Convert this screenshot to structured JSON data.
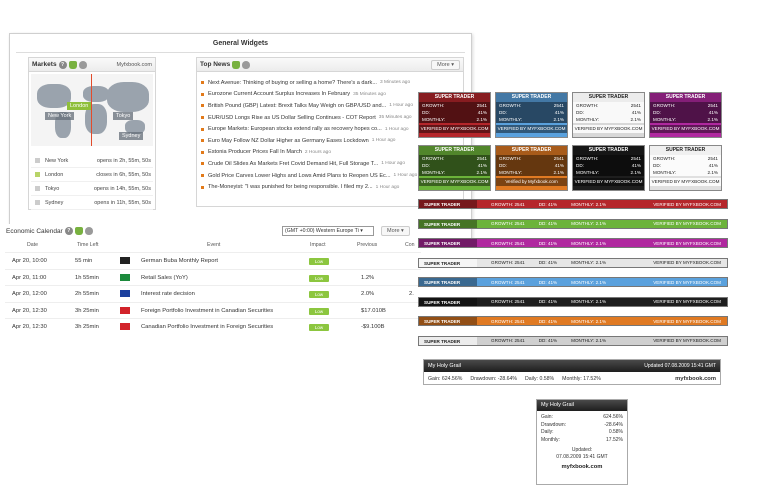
{
  "general": {
    "title": "General Widgets"
  },
  "markets": {
    "title": "Markets",
    "brand": "Myfxbook.com",
    "map_labels": [
      "London",
      "New York",
      "Tokyo",
      "Sydney"
    ],
    "rows": [
      {
        "name": "New York",
        "status": "opens in 2h, 55m, 50s"
      },
      {
        "name": "London",
        "status": "closes in 6h, 55m, 50s"
      },
      {
        "name": "Tokyo",
        "status": "opens in 14h, 55m, 50s"
      },
      {
        "name": "Sydney",
        "status": "opens in 11h, 55m, 50s"
      }
    ]
  },
  "news": {
    "title": "Top News",
    "more": "More",
    "items": [
      {
        "text": "Next Avenue: Thinking of buying or selling a home? There's a dark...",
        "time": "3 Minutes ago"
      },
      {
        "text": "Eurozone Current Account Surplus Increases In February",
        "time": "35 Minutes ago"
      },
      {
        "text": "British Pound (GBP) Latest: Brexit Talks May Weigh on GBP/USD and...",
        "time": "1 Hour ago"
      },
      {
        "text": "EUR/USD Longs Rise as US Dollar Selling Continues - COT Report",
        "time": "35 Minutes ago"
      },
      {
        "text": "Europe Markets: European stocks extend rally as recovery hopes co...",
        "time": "1 Hour ago"
      },
      {
        "text": "Euro May Follow NZ Dollar Higher as Germany Eases Lockdown",
        "time": "1 Hour ago"
      },
      {
        "text": "Estonia Producer Prices Fall In March",
        "time": "2 Hours ago"
      },
      {
        "text": "Crude Oil Slides As Markets Fret Covid Demand Hit, Full Storage T...",
        "time": "1 Hour ago"
      },
      {
        "text": "Gold Price Carves Lower Highs and Lows Amid Plans to Reopen US Ec...",
        "time": "1 Hour ago"
      },
      {
        "text": "The-Moneyist: \"I was punished for being responsible. I filed my 2...",
        "time": "1 Hour ago"
      }
    ]
  },
  "econ": {
    "title": "Economic Calendar",
    "timezone": "(GMT +0:00) Western Europe Ti",
    "more": "More",
    "columns": [
      "Date",
      "Time Left",
      "Event",
      "Impact",
      "Previous",
      "Con"
    ],
    "rows": [
      {
        "date": "Apr 20, 10:00",
        "left": "55 min",
        "event": "German Buba Monthly Report",
        "impact": "Low",
        "previous": "",
        "con": "",
        "flag": "#222222"
      },
      {
        "date": "Apr 20, 11:00",
        "left": "1h 55min",
        "event": "Retail Sales (YoY)",
        "impact": "Low",
        "previous": "1.2%",
        "con": "",
        "flag": "#1c8a3c"
      },
      {
        "date": "Apr 20, 12:00",
        "left": "2h 55min",
        "event": "Interest rate decision",
        "impact": "Low",
        "previous": "2.0%",
        "con": "2.",
        "flag": "#1b3f9e"
      },
      {
        "date": "Apr 20, 12:30",
        "left": "3h 25min",
        "event": "Foreign Portfolio Investment in Canadian Securities",
        "impact": "Low",
        "previous": "$17.010B",
        "con": "",
        "flag": "#d2232a"
      },
      {
        "date": "Apr 20, 12:30",
        "left": "3h 25min",
        "event": "Canadian Portfolio Investment in Foreign Securities",
        "impact": "Low",
        "previous": "-$9.100B",
        "con": "",
        "flag": "#d2232a"
      }
    ]
  },
  "banners": {
    "title": "SUPER TRADER",
    "growth_label": "GROWTH:",
    "growth": "2541",
    "dd_label": "DD:",
    "dd": "41%",
    "monthly_label": "MONTHLY:",
    "monthly": "2.1%",
    "verified": "VERIFIED BY MYFXBOOK.COM",
    "verified_alt": "Verified by Myfxbook.com",
    "colors": [
      "#b5262b",
      "#5aa1dd",
      "#d8d8d8",
      "#b0289f",
      "#6cb33a",
      "#e07a23",
      "#1e1e1e",
      "#e0e0e0"
    ],
    "strips": [
      "#b5262b",
      "#6cb33a",
      "#b0289f",
      "#e6e6e6",
      "#5aa1dd",
      "#1e1e1e",
      "#e07a23",
      "#cfcfcf"
    ]
  },
  "holy_h": {
    "title": "My Holy Grail",
    "updated": "Updated 07.08.2009 15:41 GMT",
    "gain": "Gain: 624.56%",
    "drawdown": "Drawdown: -28.64%",
    "daily": "Daily: 0.58%",
    "monthly": "Monthly: 17.52%",
    "logo": "myfxbook.com"
  },
  "holy_v": {
    "title": "My Holy Grail",
    "rows": [
      {
        "label": "Gain:",
        "value": "624.56%"
      },
      {
        "label": "Drawdown:",
        "value": "-28.64%"
      },
      {
        "label": "Daily:",
        "value": "0.58%"
      },
      {
        "label": "Monthly:",
        "value": "17.52%"
      }
    ],
    "updated_label": "Updated:",
    "updated_value": "07.08.2009 15:41 GMT",
    "logo": "myfxbook.com"
  }
}
